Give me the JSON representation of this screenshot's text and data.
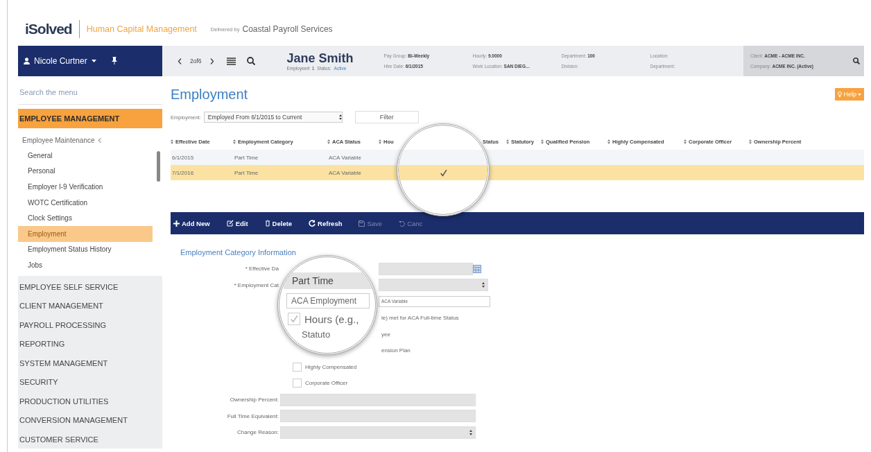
{
  "header": {
    "logo": "iSolved",
    "product": "Human Capital Management",
    "delivered_by": "Delivered by",
    "provider": "Coastal Payroll Services"
  },
  "sidebar": {
    "user": "Nicole Curtner",
    "search_placeholder": "Search the menu",
    "sections": [
      {
        "label": "EMPLOYEE MANAGEMENT",
        "expanded": true,
        "children": [
          {
            "label": "Employee Maintenance",
            "expanded": true,
            "children": [
              {
                "label": "General",
                "selected": false
              },
              {
                "label": "Personal",
                "selected": false
              },
              {
                "label": "Employer I-9 Verification",
                "selected": false
              },
              {
                "label": "WOTC Certification",
                "selected": false
              },
              {
                "label": "Clock Settings",
                "selected": false
              },
              {
                "label": "Employment",
                "selected": true
              },
              {
                "label": "Employment Status History",
                "selected": false
              },
              {
                "label": "Jobs",
                "selected": false
              }
            ]
          }
        ]
      },
      {
        "label": "EMPLOYEE SELF SERVICE",
        "expanded": false
      },
      {
        "label": "CLIENT MANAGEMENT",
        "expanded": false
      },
      {
        "label": "PAYROLL PROCESSING",
        "expanded": false
      },
      {
        "label": "REPORTING",
        "expanded": false
      },
      {
        "label": "SYSTEM MANAGEMENT",
        "expanded": false
      },
      {
        "label": "SECURITY",
        "expanded": false
      },
      {
        "label": "PRODUCTION UTILITIES",
        "expanded": false
      },
      {
        "label": "CONVERSION MANAGEMENT",
        "expanded": false
      },
      {
        "label": "CUSTOMER SERVICE",
        "expanded": false
      }
    ]
  },
  "record_bar": {
    "position": "2of6",
    "employee": {
      "name": "Jane Smith",
      "number": "Employee#: **1**",
      "status_label": "Status:",
      "status": "Active"
    },
    "info": [
      {
        "lines": [
          "Pay Group: **Bi-Weekly**",
          "Hire Date: **6/1/2015**"
        ]
      },
      {
        "lines": [
          "Hourly: **9.0000**",
          "Work Location: **SAN DIEG...**"
        ]
      },
      {
        "lines": [
          "Department: **100**",
          "Division:"
        ]
      },
      {
        "lines": [
          "Location:",
          "Department:"
        ]
      }
    ],
    "client": {
      "lines": [
        "Client: **ACME - ACME INC.**",
        "Company: **ACME INC. (Active)**"
      ]
    }
  },
  "page": {
    "title": "Employment",
    "help": "Help",
    "filter_label": "Employment:",
    "filter_value": "Employed From 6/1/2015 to Current",
    "filter_button": "Filter"
  },
  "table": {
    "columns": [
      {
        "label": "Effective Date",
        "kind": "sort"
      },
      {
        "label": "Employment Category",
        "kind": "sort"
      },
      {
        "label": "ACA Status",
        "kind": "sort"
      },
      {
        "label": "Hou",
        "kind": "sort"
      },
      {
        "label": "Status",
        "kind": "cut"
      },
      {
        "label": "Statutory",
        "kind": "sort"
      },
      {
        "label": "Qualified Pension",
        "kind": "sort"
      },
      {
        "label": "Highly Compensated",
        "kind": "sort"
      },
      {
        "label": "Corporate Officer",
        "kind": "sort"
      },
      {
        "label": "Ownership Percent",
        "kind": "sort"
      }
    ],
    "rows": [
      {
        "cells": [
          "6/1/2015",
          "Part Time",
          "ACA Variable"
        ],
        "selected": false,
        "hours_checked": false
      },
      {
        "cells": [
          "7/1/2016",
          "Part Time",
          "ACA Variable"
        ],
        "selected": true,
        "hours_checked": true
      }
    ]
  },
  "toolbar": [
    {
      "label": "Add New",
      "kind": "add",
      "disabled": false
    },
    {
      "label": "Edit",
      "kind": "edit",
      "disabled": false
    },
    {
      "label": "Delete",
      "kind": "delete",
      "disabled": false
    },
    {
      "label": "Refresh",
      "kind": "refresh",
      "disabled": false
    },
    {
      "label": "Save",
      "kind": "save",
      "disabled": true
    },
    {
      "label": "Canc",
      "kind": "cancel",
      "disabled": true
    }
  ],
  "form": {
    "title": "Employment Category Information",
    "rows": [
      {
        "kind": "date",
        "label": "* Effective Da"
      },
      {
        "kind": "select",
        "label": "* Employment Cat"
      },
      {
        "kind": "text",
        "value": "ACA Variable"
      },
      {
        "kind": "note",
        "label": "le) met for ACA Full-time Status"
      },
      {
        "kind": "note",
        "label": "yee"
      },
      {
        "kind": "note",
        "label": "ension Plan"
      },
      {
        "kind": "checkbox",
        "label": "Highly Compensated",
        "checked": false
      },
      {
        "kind": "checkbox",
        "label": "Corporate Officer",
        "checked": false
      },
      {
        "kind": "input",
        "label": "Ownership Percent:"
      },
      {
        "kind": "input",
        "label": "Full Time Equivalent:"
      },
      {
        "kind": "dropdown",
        "label": "Change Reason:"
      }
    ]
  },
  "form_magnifier": {
    "field_value": "Part Time",
    "field_label": "ACA Employment",
    "checkbox_label": "Hours (e.g.,",
    "checked": true,
    "next_label": "Statuto"
  }
}
